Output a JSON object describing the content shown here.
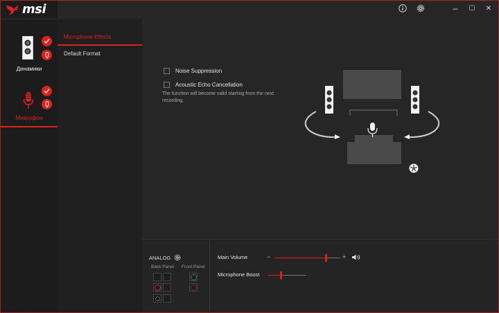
{
  "app": {
    "brand": "msi"
  },
  "titlebar": {
    "info_icon": "info-icon",
    "settings_icon": "gear-icon",
    "minimize": "–",
    "maximize": "☐",
    "close": "✕"
  },
  "devices": [
    {
      "label": "Динамики",
      "icon": "speaker-icon",
      "active": false
    },
    {
      "label": "Микрофон",
      "icon": "microphone-icon",
      "active": true
    }
  ],
  "tabs": [
    {
      "label": "Microphone Effects",
      "active": true
    },
    {
      "label": "Default Format",
      "active": false
    }
  ],
  "effects": {
    "noise_suppression": {
      "label": "Noise Suppression",
      "checked": false
    },
    "echo_cancellation": {
      "label": "Acoustic Echo Cancellation",
      "checked": false
    },
    "note": "The function will become valid starting from the next recording."
  },
  "analog": {
    "title": "ANALOG",
    "back_panel": "Back Panel",
    "front_panel": "Front Panel"
  },
  "volume": {
    "main_label": "Main Volume",
    "main_level": 0.78,
    "minus": "−",
    "plus": "+",
    "boost_label": "Microphone Boost",
    "boost_level": 0.33
  },
  "colors": {
    "accent": "#e0201c",
    "background": "#262626",
    "sidebar": "#1c1c1c"
  }
}
